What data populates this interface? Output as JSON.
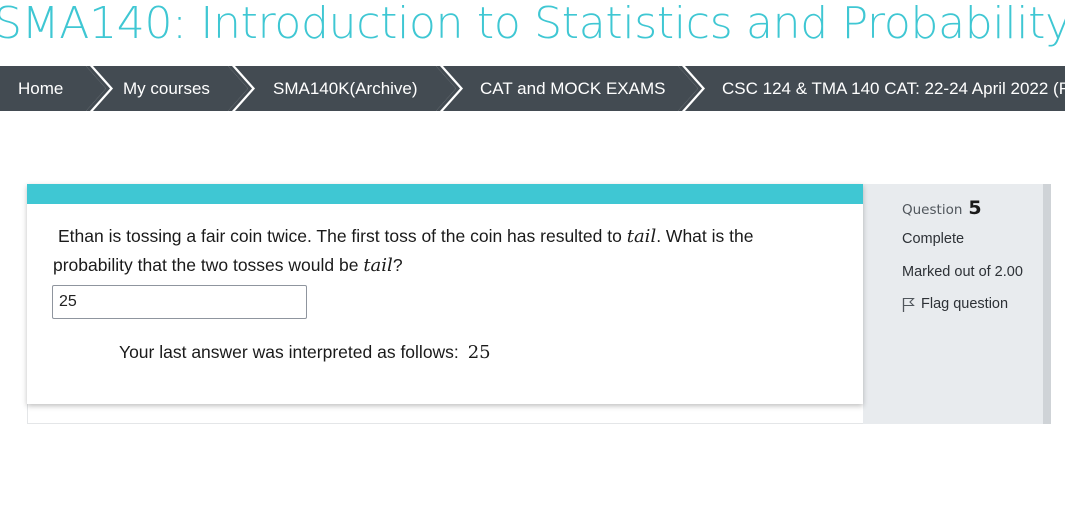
{
  "course": {
    "title": "SMA140: Introduction to Statistics and Probability"
  },
  "breadcrumb": {
    "items": [
      {
        "label": "Home"
      },
      {
        "label": "My courses"
      },
      {
        "label": "SMA140K(Archive)"
      },
      {
        "label": "CAT and MOCK EXAMS"
      },
      {
        "label": "CSC 124 & TMA 140 CAT: 22-24 April 2022 (F"
      }
    ]
  },
  "question": {
    "text_part1": "Ethan is tossing a fair coin twice. The first toss of the coin has resulted to ",
    "math_1": "tail",
    "text_part2": ". What is the",
    "text_part3": "probability that the two tosses would be ",
    "math_2": "tail",
    "text_part4": "?",
    "answer_value": "25",
    "interpretation_label": "Your last answer was interpreted as follows:",
    "interpretation_value": "25"
  },
  "info": {
    "question_label": "Question",
    "question_number": "5",
    "state": "Complete",
    "marks": "Marked out of 2.00",
    "flag_label": "Flag question"
  },
  "colors": {
    "accent": "#3fc7d3",
    "nav_bg": "#434b52",
    "info_bg": "#e8ebee"
  }
}
